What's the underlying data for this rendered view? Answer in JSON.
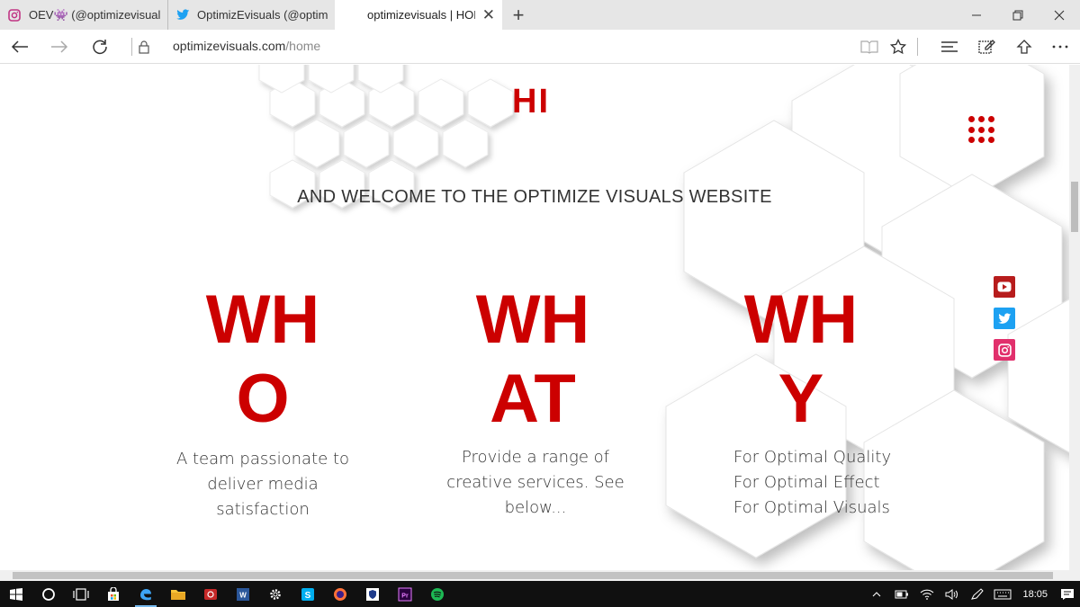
{
  "browser": {
    "tabs": [
      {
        "title": "OEV👾 (@optimizevisuals)",
        "icon": "instagram-icon"
      },
      {
        "title": "OptimizEvisuals (@optimize",
        "icon": "twitter-icon"
      },
      {
        "title": "optimizevisuals | HOME",
        "icon": "",
        "active": true
      }
    ],
    "address": {
      "domain": "optimizevisuals.com",
      "path": "/home"
    }
  },
  "page": {
    "hi": "HI",
    "welcome": "AND WELCOME TO THE OPTIMIZE VISUALS WEBSITE",
    "columns": [
      {
        "line1": "WH",
        "line2": "O",
        "desc": [
          "A team passionate to",
          "deliver media",
          "satisfaction"
        ]
      },
      {
        "line1": "WH",
        "line2": "AT",
        "desc": [
          "Provide a range of",
          "creative services. See",
          "below..."
        ]
      },
      {
        "line1": "WH",
        "line2": "Y",
        "desc": [
          "For Optimal Quality",
          "For Optimal Effect",
          "For Optimal Visuals"
        ]
      }
    ],
    "social": [
      "youtube-icon",
      "twitter-icon",
      "instagram-icon"
    ],
    "accent": "#cc0000"
  },
  "taskbar": {
    "clock": "18:05"
  }
}
